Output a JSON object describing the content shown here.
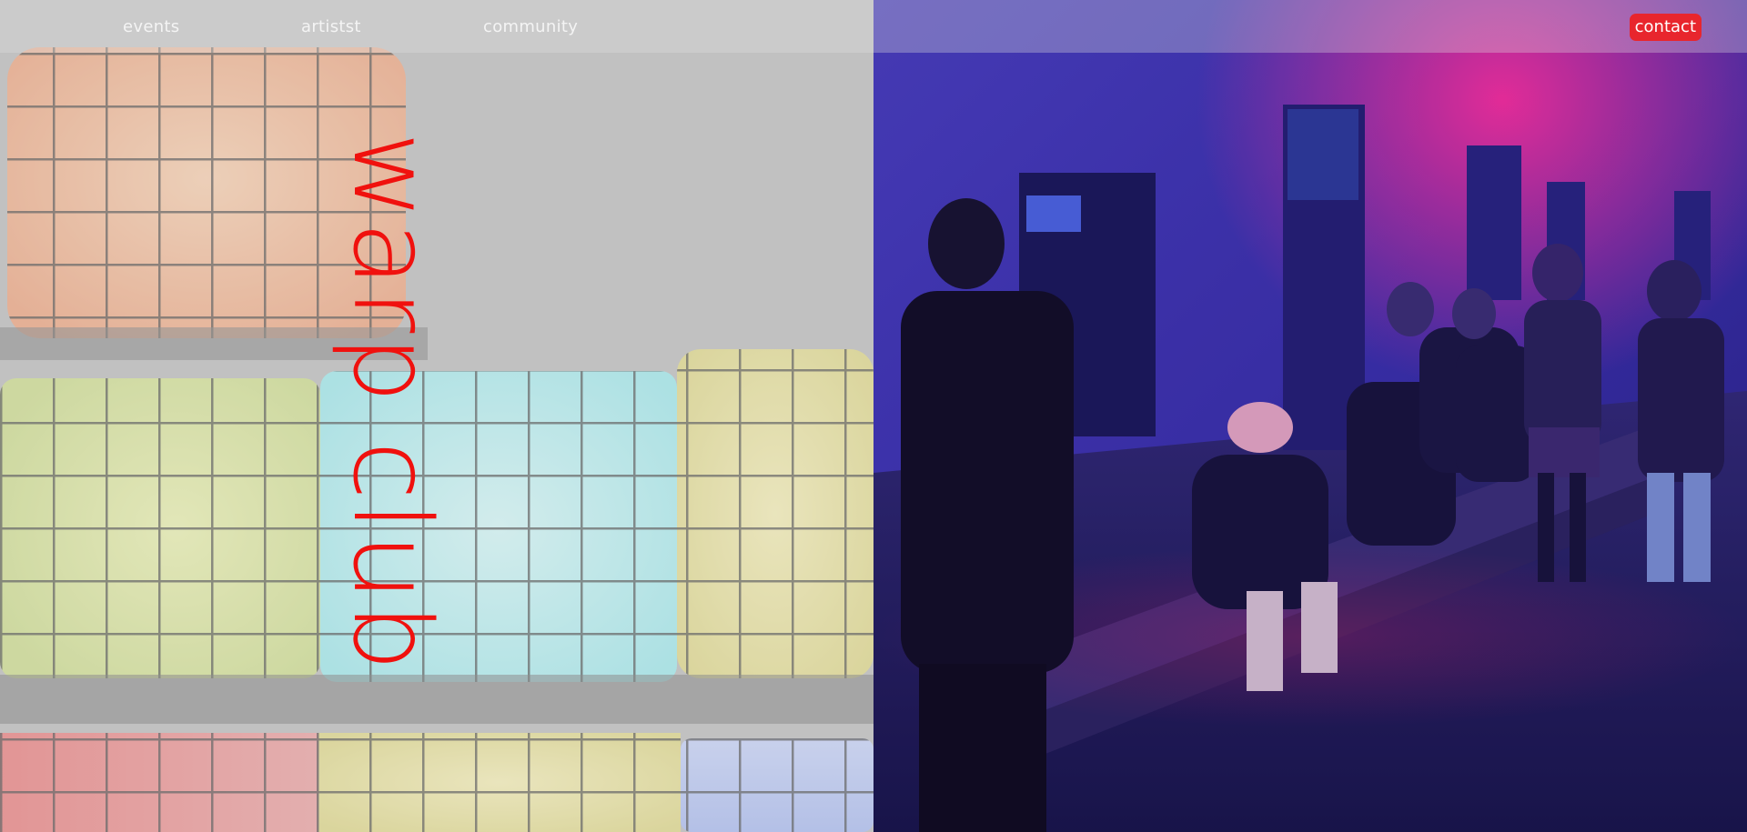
{
  "nav": {
    "events": "events",
    "artists": "artistst",
    "community": "community",
    "contact": "contact"
  },
  "hero": {
    "title": "warp club"
  },
  "colors": {
    "accent": "#f0110e",
    "contact_bg": "#e8262d",
    "nav_text": "#f4f4f4"
  },
  "icons": {
    "left_image": "illuminated-tanks-image",
    "right_image": "night-crowd-photo"
  }
}
